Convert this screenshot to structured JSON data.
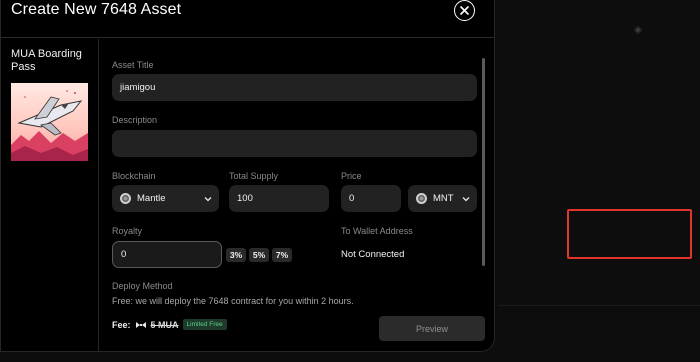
{
  "modal": {
    "title": "Create New 7648 Asset"
  },
  "asset": {
    "name": "MUA Boarding Pass"
  },
  "form": {
    "asset_title_label": "Asset Title",
    "asset_title_value": "jiamigou",
    "description_label": "Description",
    "description_value": "",
    "blockchain_label": "Blockchain",
    "blockchain_value": "Mantle",
    "total_supply_label": "Total Supply",
    "total_supply_value": "100",
    "price_label": "Price",
    "price_value": "0",
    "currency_value": "MNT",
    "royalty_label": "Royalty",
    "royalty_value": "0",
    "royalty_options": [
      "3%",
      "5%",
      "7%"
    ],
    "wallet_label": "To Wallet Address",
    "wallet_value": "Not Connected"
  },
  "deploy": {
    "label": "Deploy Method",
    "text": "Free: we will deploy the 7648 contract for you within 2 hours.",
    "fee_label": "Fee:",
    "fee_old": "5 MUA",
    "fee_badge": "Limited Free",
    "preview_label": "Preview"
  },
  "colors": {
    "highlight": "#e0352c",
    "badge_green": "#5fd08a"
  }
}
